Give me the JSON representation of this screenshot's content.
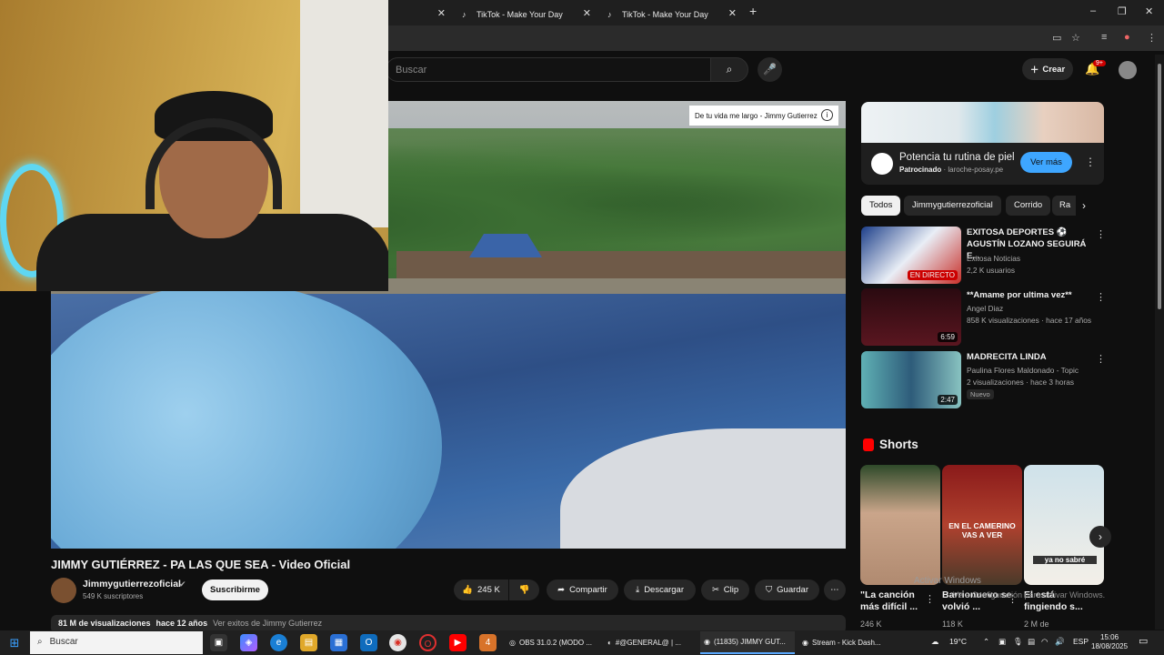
{
  "browser": {
    "tabs": [
      {
        "label": ""
      },
      {
        "label": "TikTok - Make Your Day"
      },
      {
        "label": "TikTok - Make Your Day"
      }
    ],
    "new_tab": "+",
    "window_controls": {
      "minimize": "–",
      "maximize": "❐",
      "close": "✕"
    }
  },
  "youtube": {
    "search_placeholder": "Buscar",
    "create_label": "Crear",
    "notifications_badge": "9+"
  },
  "video": {
    "overlay_text": "De tu vida me largo - Jimmy Gutierrez",
    "title": "JIMMY GUTIÉRREZ - PA LAS QUE SEA - Video Oficial",
    "channel": "Jimmygutierrezoficial",
    "subscribers": "549 K suscriptores",
    "subscribe_label": "Suscribirme",
    "likes": "245 K",
    "share_label": "Compartir",
    "download_label": "Descargar",
    "clip_label": "Clip",
    "save_label": "Guardar",
    "views": "81 M de visualizaciones",
    "age": "hace 12 años",
    "desc_link": "Ver exitos de Jimmy Gutierrez"
  },
  "ad": {
    "title": "Potencia tu rutina de piel",
    "sponsored": "Patrocinado",
    "domain": "laroche-posay.pe",
    "cta": "Ver más"
  },
  "chips": [
    "Todos",
    "Jimmygutierrezoficial",
    "Corrido",
    "Ra"
  ],
  "recommendations": [
    {
      "title": "EXITOSA DEPORTES ⚽ AGUSTÍN LOZANO SEGUIRÁ E...",
      "channel": "Exitosa Noticias",
      "meta": "2,2 K usuarios",
      "badge": "EN DIRECTO"
    },
    {
      "title": "**Amame por ultima vez**",
      "channel": "Angel Diaz",
      "meta": "858 K visualizaciones · hace 17 años",
      "duration": "6:59"
    },
    {
      "title": "MADRECITA LINDA",
      "channel": "Paulina Flores Maldonado - Topic",
      "meta": "2 visualizaciones · hace 3 horas",
      "duration": "2:47",
      "tag": "Nuevo"
    }
  ],
  "shorts": {
    "heading": "Shorts",
    "items": [
      {
        "title": "\"La canción más difícil ...",
        "views": "246 K"
      },
      {
        "title": "Barrionuevo se volvió ...",
        "views": "118 K",
        "overlay": "EN EL CAMERINO VAS A VER"
      },
      {
        "title": "El está fingiendo s...",
        "views": "2 M de",
        "overlay": "ya no sabré"
      }
    ]
  },
  "watermark": {
    "line1": "Activar Windows",
    "line2": "Ve a Configuración para activar Windows."
  },
  "taskbar": {
    "search": "Buscar",
    "apps": [
      {
        "label": "OBS 31.0.2 (MODO ..."
      },
      {
        "label": "#@GENERAL@ | ..."
      },
      {
        "label": "(11835) JIMMY GUT..."
      },
      {
        "label": "Stream - Kick Dash..."
      }
    ],
    "weather": "19°C",
    "lang": "ESP",
    "time": "15:06",
    "date": "18/08/2025"
  },
  "colors": {
    "accent": "#3ea6ff",
    "brand_red": "#ff0000",
    "bg": "#0f0f0f"
  }
}
